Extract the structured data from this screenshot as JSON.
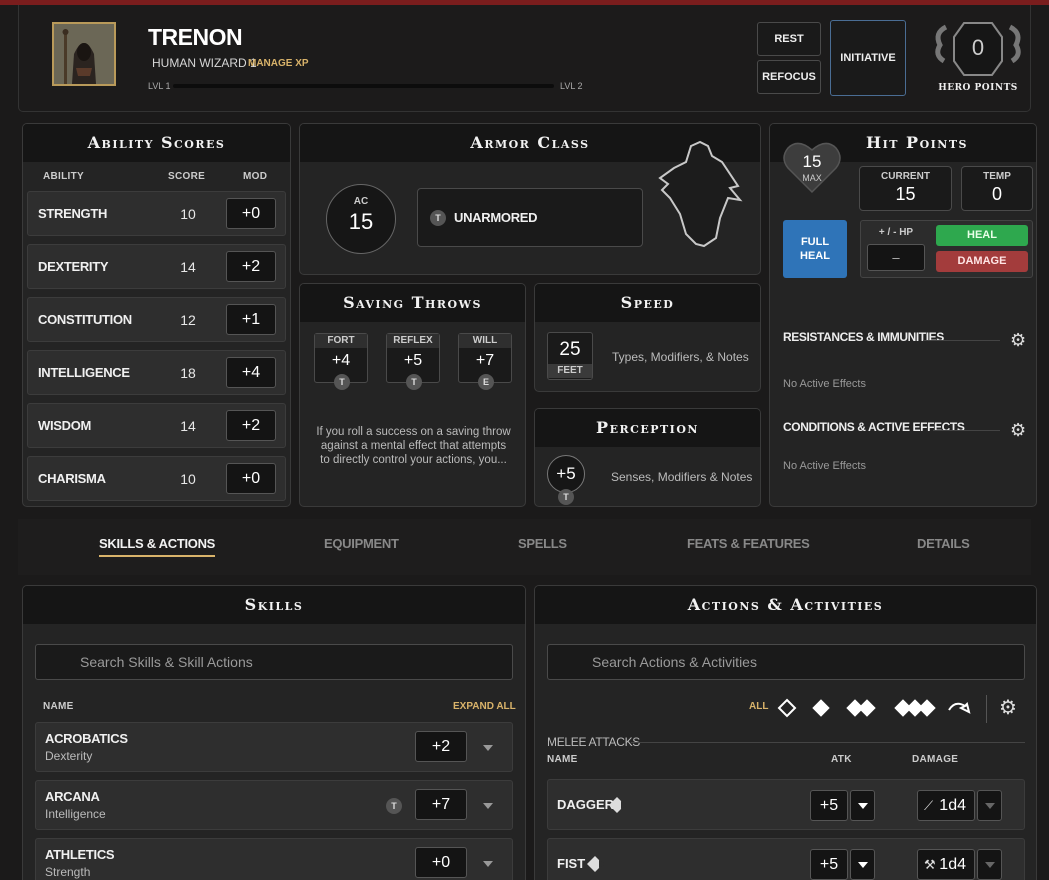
{
  "header": {
    "name": "TRENON",
    "subtitle": "HUMAN WIZARD 1",
    "manage_xp": "MANAGE XP",
    "lvl_left": "LVL 1",
    "lvl_right": "LVL 2",
    "xp_progress": 0,
    "rest": "REST",
    "refocus": "REFOCUS",
    "initiative": "INITIATIVE",
    "hero_points_value": "0",
    "hero_points_label": "HERO POINTS"
  },
  "abilities": {
    "title": "Ability Scores",
    "col_ability": "ABILITY",
    "col_score": "SCORE",
    "col_mod": "MOD",
    "rows": [
      {
        "name": "STRENGTH",
        "score": "10",
        "mod": "+0"
      },
      {
        "name": "DEXTERITY",
        "score": "14",
        "mod": "+2"
      },
      {
        "name": "CONSTITUTION",
        "score": "12",
        "mod": "+1"
      },
      {
        "name": "INTELLIGENCE",
        "score": "18",
        "mod": "+4"
      },
      {
        "name": "WISDOM",
        "score": "14",
        "mod": "+2"
      },
      {
        "name": "CHARISMA",
        "score": "10",
        "mod": "+0"
      }
    ]
  },
  "armor": {
    "title": "Armor Class",
    "ac_label": "AC",
    "ac_value": "15",
    "badge": "T",
    "armor_name": "UNARMORED"
  },
  "saves": {
    "title": "Saving Throws",
    "items": [
      {
        "label": "FORT",
        "value": "+4",
        "prof": "T"
      },
      {
        "label": "REFLEX",
        "value": "+5",
        "prof": "T"
      },
      {
        "label": "WILL",
        "value": "+7",
        "prof": "E"
      }
    ],
    "note_line1": "If you roll a success on a saving throw",
    "note_line2": "against a mental effect that attempts",
    "note_line3": "to directly control your actions, you..."
  },
  "speed": {
    "title": "Speed",
    "value": "25",
    "unit": "FEET",
    "notes": "Types, Modifiers, & Notes"
  },
  "perception": {
    "title": "Perception",
    "value": "+5",
    "prof": "T",
    "notes": "Senses, Modifiers & Notes"
  },
  "hp": {
    "title": "Hit Points",
    "max_value": "15",
    "max_label": "MAX",
    "current_label": "CURRENT",
    "current_value": "15",
    "temp_label": "TEMP",
    "temp_value": "0",
    "full_heal_1": "FULL",
    "full_heal_2": "HEAL",
    "pm_label": "+ / - HP",
    "pm_value": "–",
    "heal": "HEAL",
    "damage": "DAMAGE",
    "resist_label": "RESISTANCES & IMMUNITIES",
    "resist_empty": "No Active Effects",
    "cond_label": "CONDITIONS & ACTIVE EFFECTS",
    "cond_empty": "No Active Effects"
  },
  "tabs": [
    "SKILLS & ACTIONS",
    "EQUIPMENT",
    "SPELLS",
    "FEATS & FEATURES",
    "DETAILS"
  ],
  "skills": {
    "title": "Skills",
    "search_placeholder": "Search Skills & Skill Actions",
    "col_name": "NAME",
    "expand_all": "EXPAND ALL",
    "rows": [
      {
        "name": "ACROBATICS",
        "ability": "Dexterity",
        "mod": "+2",
        "prof": ""
      },
      {
        "name": "ARCANA",
        "ability": "Intelligence",
        "mod": "+7",
        "prof": "T"
      },
      {
        "name": "ATHLETICS",
        "ability": "Strength",
        "mod": "+0",
        "prof": ""
      }
    ]
  },
  "actions": {
    "title": "Actions & Activities",
    "search_placeholder": "Search Actions & Activities",
    "filter_all": "ALL",
    "section": "MELEE ATTACKS",
    "col_name": "NAME",
    "col_atk": "ATK",
    "col_damage": "DAMAGE",
    "rows": [
      {
        "name": "DAGGER",
        "atk": "+5",
        "damage": "1d4",
        "damage_icon": "dagger-icon"
      },
      {
        "name": "FIST",
        "atk": "+5",
        "damage": "1d4",
        "damage_icon": "hammer-icon"
      }
    ]
  },
  "colors": {
    "accent_gold": "#d9b36a",
    "heal_green": "#2ea84e",
    "damage_red": "#a33c3c",
    "full_heal_blue": "#2f74b8",
    "top_bar": "#7a1d1d"
  }
}
